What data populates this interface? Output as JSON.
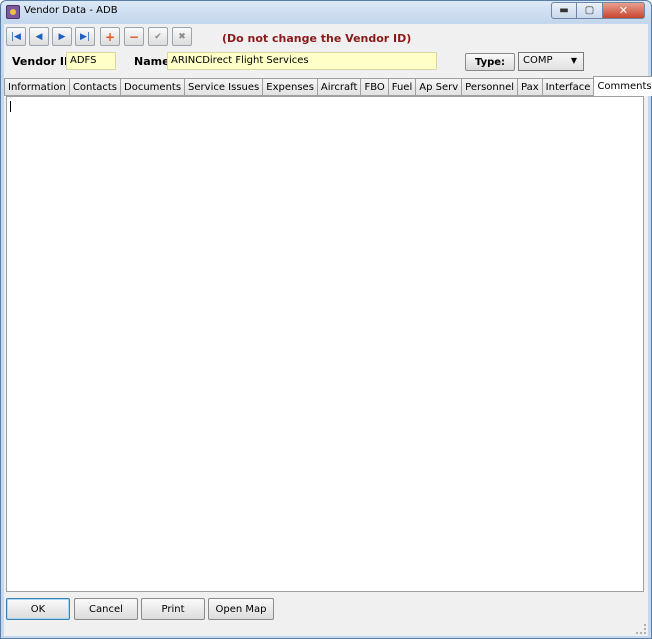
{
  "window": {
    "title": "Vendor Data - ADB",
    "controls": {
      "minimize": "▬",
      "maximize": "▢",
      "close": "✕"
    }
  },
  "toolbar": {
    "first": "|◀",
    "prev": "◀",
    "next": "▶",
    "last": "▶|",
    "add": "+",
    "remove": "−",
    "confirm": "✔",
    "cancel": "✖",
    "warning": "(Do not change the Vendor ID)"
  },
  "header": {
    "vendor_id_label": "Vendor ID:",
    "vendor_id_value": "ADFS",
    "name_label": "Name:",
    "name_value": "ARINCDirect Flight Services",
    "type_button_label": "Type:",
    "type_value": "COMP"
  },
  "tabs": [
    {
      "label": "Information"
    },
    {
      "label": "Contacts"
    },
    {
      "label": "Documents"
    },
    {
      "label": "Service Issues"
    },
    {
      "label": "Expenses"
    },
    {
      "label": "Aircraft"
    },
    {
      "label": "FBO"
    },
    {
      "label": "Fuel"
    },
    {
      "label": "Ap Serv"
    },
    {
      "label": "Personnel"
    },
    {
      "label": "Pax"
    },
    {
      "label": "Interface"
    },
    {
      "label": "Comments"
    }
  ],
  "active_tab": "Comments",
  "comments": {
    "value": ""
  },
  "buttons": {
    "ok": "OK",
    "cancel": "Cancel",
    "print": "Print",
    "open_map": "Open Map"
  },
  "colors": {
    "field_bg": "#ffffc8",
    "warning": "#8b1a1a",
    "nav_blue": "#1f5fbf",
    "add_remove": "#e05a28"
  }
}
